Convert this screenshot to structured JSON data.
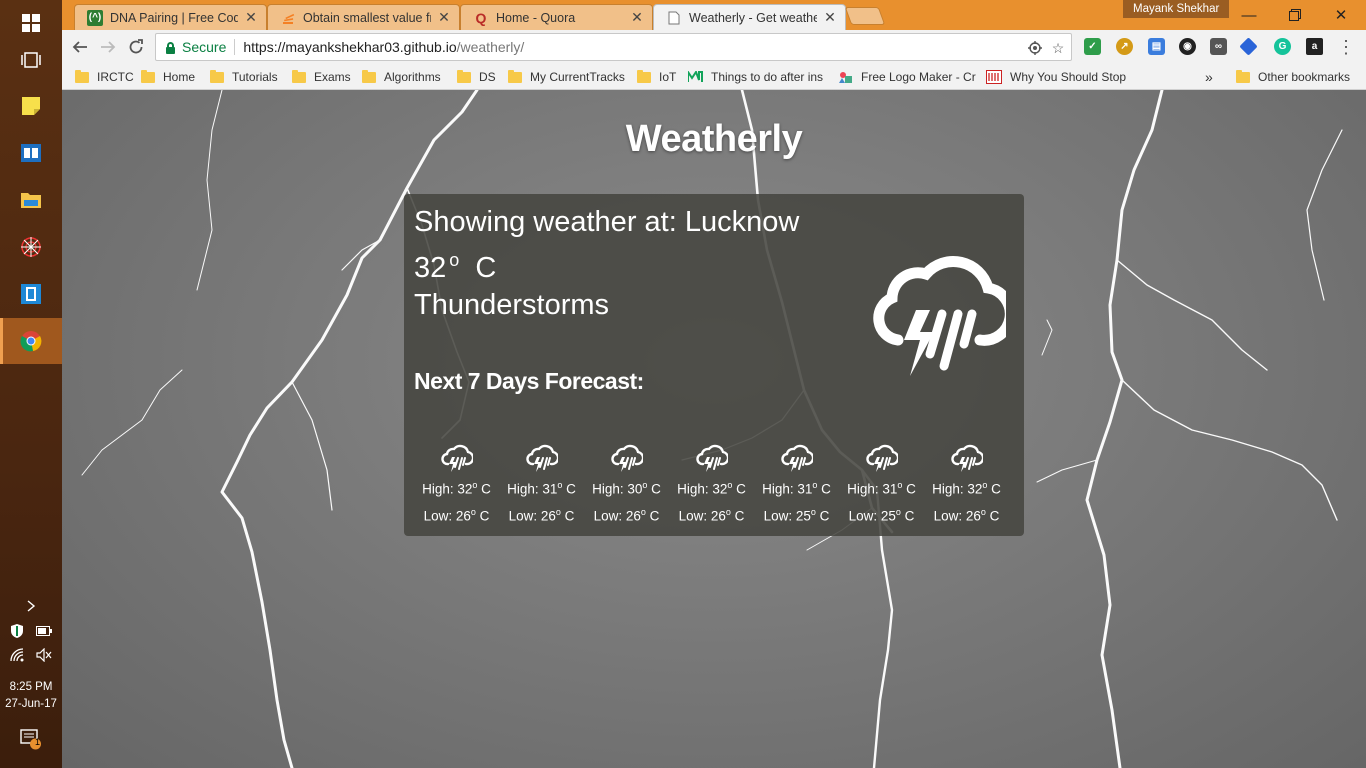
{
  "browser": {
    "tabs": [
      {
        "label": "DNA Pairing | Free Code",
        "icon": "freecodecamp-icon",
        "color": "#2e7d32"
      },
      {
        "label": "Obtain smallest value fro",
        "icon": "stackoverflow-icon",
        "color": "#f48024"
      },
      {
        "label": "Home - Quora",
        "icon": "quora-icon",
        "color": "#b92b27"
      },
      {
        "label": "Weatherly - Get weather",
        "icon": "page-icon",
        "color": "#777777"
      }
    ],
    "profile_name": "Mayank Shekhar",
    "secure_label": "Secure",
    "url_host": "https://mayankshekhar03.github.io",
    "url_path": "/weatherly/",
    "bookmarks": [
      {
        "label": "IRCTC",
        "icon": "folder-icon"
      },
      {
        "label": "Home",
        "icon": "folder-icon"
      },
      {
        "label": "Tutorials",
        "icon": "folder-icon"
      },
      {
        "label": "Exams",
        "icon": "folder-icon"
      },
      {
        "label": "Algorithms",
        "icon": "folder-icon"
      },
      {
        "label": "DS",
        "icon": "folder-icon"
      },
      {
        "label": "My CurrentTracks",
        "icon": "folder-icon"
      },
      {
        "label": "IoT",
        "icon": "folder-icon"
      },
      {
        "label": "Things to do after ins",
        "icon": "medium-icon"
      },
      {
        "label": "Free Logo Maker - Cr",
        "icon": "logo-maker-icon"
      },
      {
        "label": "Why You Should Stop",
        "icon": "bookmark-page-icon"
      }
    ],
    "more_bookmarks": "»",
    "other_bookmarks": "Other bookmarks"
  },
  "taskbar": {
    "time": "8:25 PM",
    "date": "27-Jun-17",
    "notifications_count": "1"
  },
  "app": {
    "title": "Weatherly",
    "location_line": "Showing weather at: Lucknow",
    "temperature": "32",
    "unit": "C",
    "condition": "Thunderstorms",
    "forecast_title": "Next 7 Days Forecast:",
    "condition_icon": "thunderstorm-icon",
    "forecast": [
      {
        "high": "High: 32",
        "low": "Low: 26"
      },
      {
        "high": "High: 31",
        "low": "Low: 26"
      },
      {
        "high": "High: 30",
        "low": "Low: 26"
      },
      {
        "high": "High: 32",
        "low": "Low: 26"
      },
      {
        "high": "High: 31",
        "low": "Low: 25"
      },
      {
        "high": "High: 31",
        "low": "Low: 25"
      },
      {
        "high": "High: 32",
        "low": "Low: 26"
      }
    ],
    "forecast_unit": "C"
  }
}
